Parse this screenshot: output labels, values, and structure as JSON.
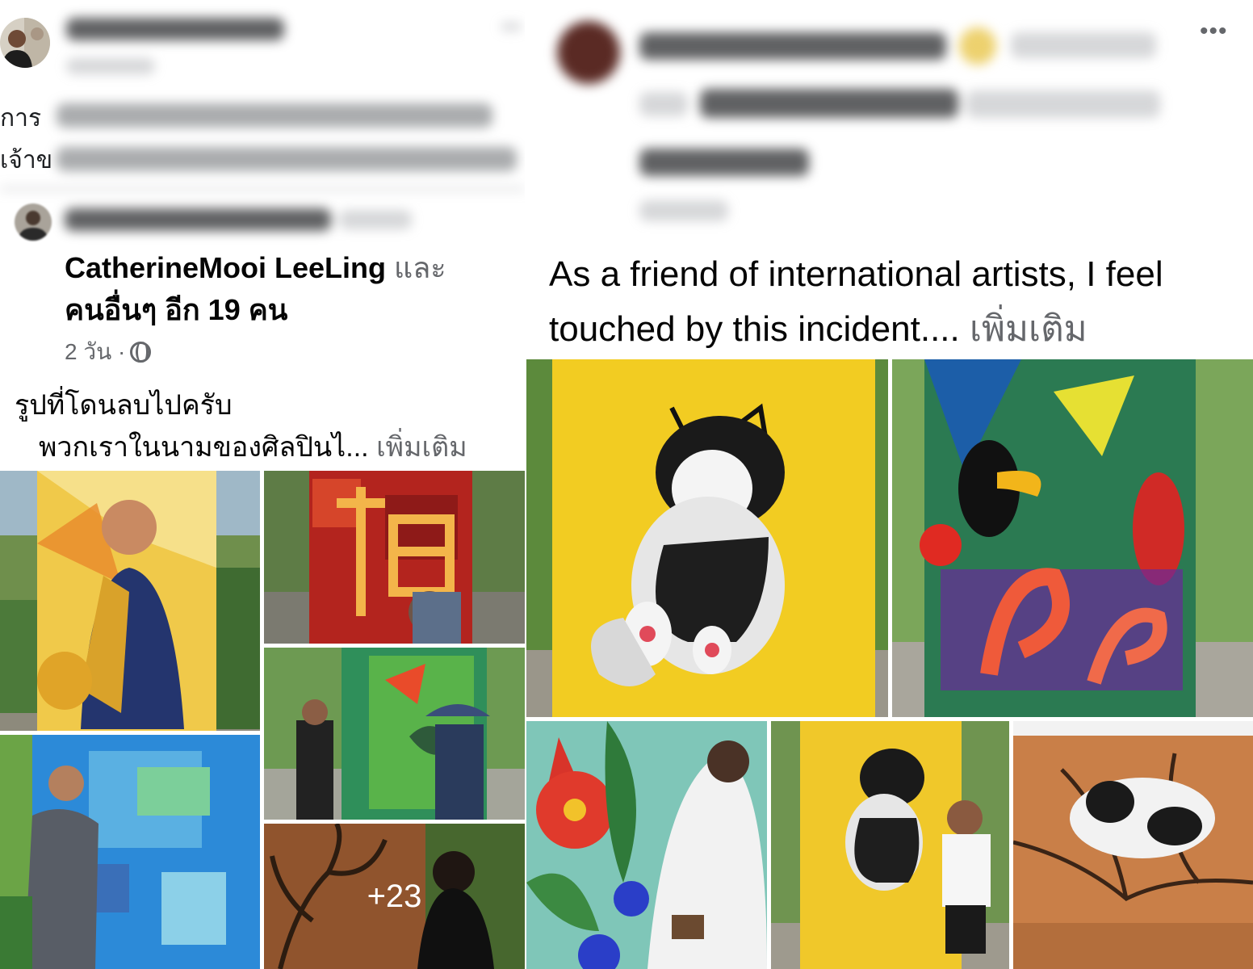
{
  "left_post": {
    "truncated_body": [
      "การ",
      "เจ้าข"
    ],
    "author_primary": "CatherineMooi LeeLing",
    "author_conjunction": "และ",
    "author_others": "คนอื่นๆ อีก 19 คน",
    "timestamp": "2 วัน ·",
    "body_line1": "รูปที่โดนลบไปครับ",
    "body_line2": "พวกเราในนามของศิลปินไ...",
    "see_more": "เพิ่มเติม",
    "more_photos": "+23",
    "photos": [
      {
        "name": "saxophone-portrait-mural-photo"
      },
      {
        "name": "fu-character-mural-photo"
      },
      {
        "name": "artists-painting-flowers-photo"
      },
      {
        "name": "blue-mural-man-photo"
      },
      {
        "name": "tree-mural-woman-photo"
      }
    ]
  },
  "right_post": {
    "menu_icon": "more-options-icon",
    "text": "As a friend of international artists, I feel touched by this incident....",
    "see_more": "เพิ่มเติม",
    "photos": [
      {
        "name": "sleeping-cat-mural-photo"
      },
      {
        "name": "tropical-birds-mural-photo"
      },
      {
        "name": "flower-mural-painter-photo"
      },
      {
        "name": "cat-mural-man-photo"
      },
      {
        "name": "brown-cat-mural-photo"
      }
    ]
  },
  "colors": {
    "text_primary": "#050505",
    "text_secondary": "#65676b",
    "background": "#ffffff"
  }
}
